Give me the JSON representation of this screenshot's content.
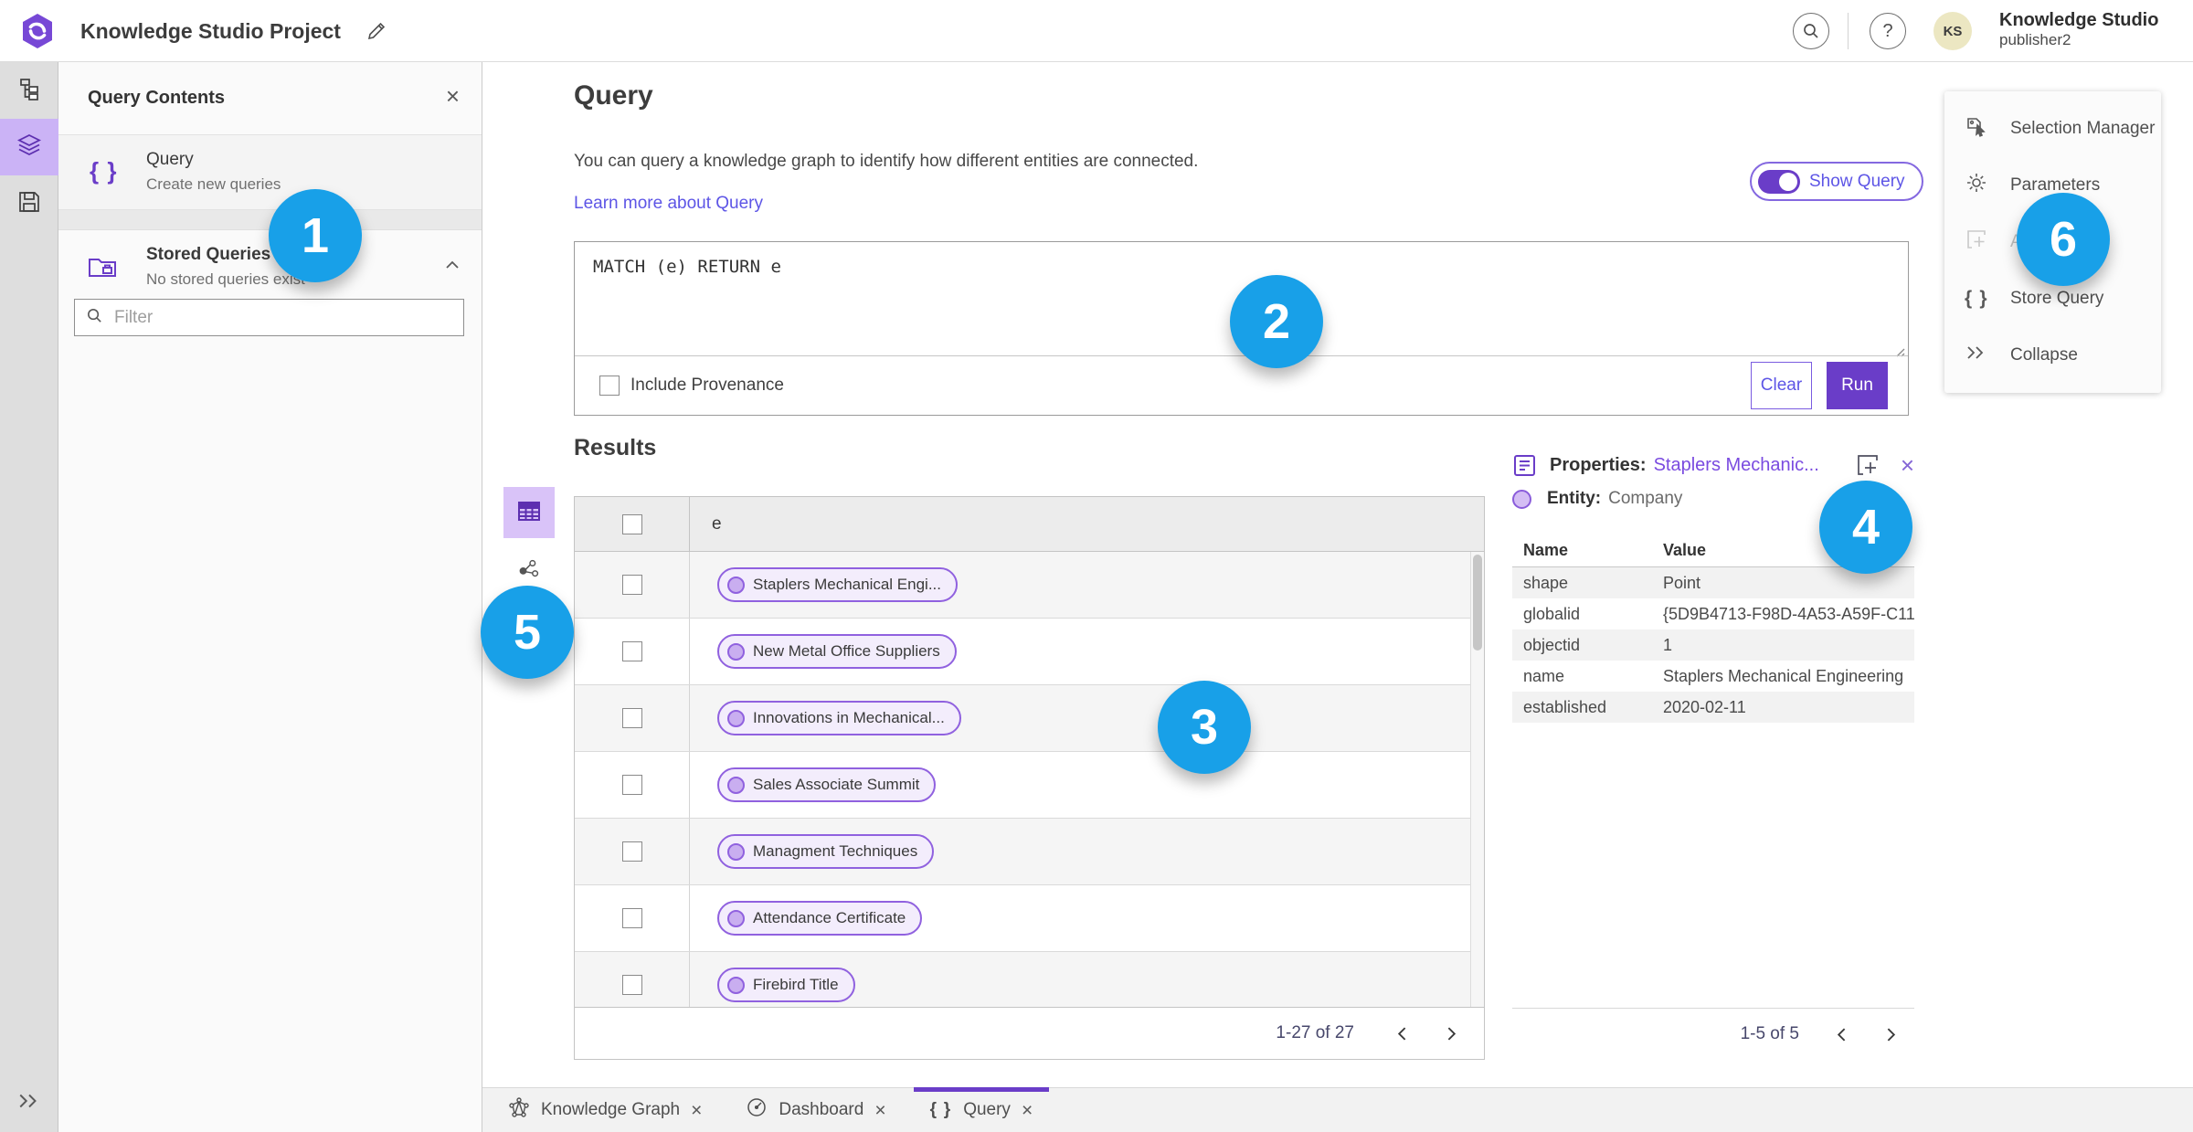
{
  "colors": {
    "accent_purple": "#6a3dc8",
    "selection_light_purple": "#cbb3f6",
    "pill_border_purple": "#9061df",
    "link_purple": "#5d55e6",
    "properties_link_purple": "#7a4be0",
    "annotation_blue": "#18a0e8",
    "avatar_yellow": "#ece7c2"
  },
  "header": {
    "title": "Knowledge Studio Project",
    "account_name": "Knowledge Studio",
    "account_user": "publisher2",
    "avatar_initials": "KS"
  },
  "contents_panel": {
    "title": "Query Contents",
    "query_item": {
      "title": "Query",
      "subtitle": "Create new queries"
    },
    "stored_item": {
      "title": "Stored Queries",
      "subtitle": "No stored queries exist"
    },
    "filter_placeholder": "Filter"
  },
  "query_section": {
    "title": "Query",
    "description": "You can query a knowledge graph to identify how different entities are connected.",
    "learn_more": "Learn more about Query",
    "show_query_label": "Show Query",
    "query_text": "MATCH (e) RETURN e",
    "include_provenance_label": "Include Provenance",
    "clear_label": "Clear",
    "run_label": "Run"
  },
  "results": {
    "title": "Results",
    "column_header": "e",
    "rows": [
      "Staplers Mechanical Engi...",
      "New Metal Office Suppliers",
      "Innovations in Mechanical...",
      "Sales Associate Summit",
      "Managment Techniques",
      "Attendance Certificate",
      "Firebird Title"
    ],
    "pagination": "1-27 of 27"
  },
  "properties": {
    "title_label": "Properties:",
    "title_link": "Staplers Mechanic...",
    "entity_label": "Entity:",
    "entity_value": "Company",
    "col_name": "Name",
    "col_value": "Value",
    "rows": [
      {
        "name": "shape",
        "value": "Point"
      },
      {
        "name": "globalid",
        "value": "{5D9B4713-F98D-4A53-A59F-C11..."
      },
      {
        "name": "objectid",
        "value": "1"
      },
      {
        "name": "name",
        "value": "Staplers Mechanical Engineering"
      },
      {
        "name": "established",
        "value": "2020-02-11"
      }
    ],
    "pagination": "1-5 of 5"
  },
  "side_menu": {
    "items": [
      {
        "label": "Selection Manager"
      },
      {
        "label": "Parameters"
      },
      {
        "label": "Add",
        "disabled": true
      },
      {
        "label": "Store Query"
      },
      {
        "label": "Collapse"
      }
    ]
  },
  "tabs": [
    {
      "label": "Knowledge Graph"
    },
    {
      "label": "Dashboard"
    },
    {
      "label": "Query",
      "active": true
    }
  ],
  "annotations": [
    "1",
    "2",
    "3",
    "4",
    "5",
    "6"
  ]
}
